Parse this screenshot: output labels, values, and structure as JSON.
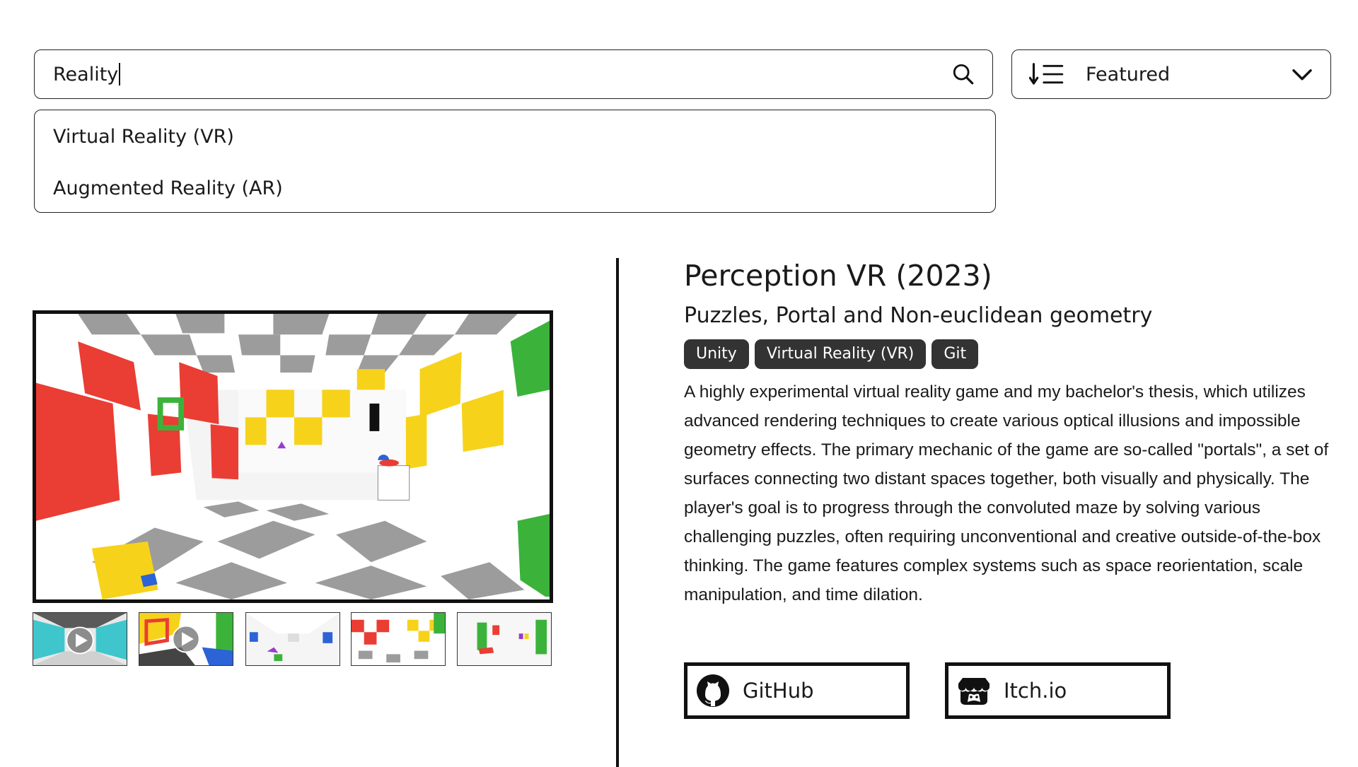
{
  "search": {
    "value": "Reality"
  },
  "sort": {
    "selected": "Featured",
    "icon": "sort-descending-icon"
  },
  "suggestions": [
    {
      "label": "Virtual Reality (VR)"
    },
    {
      "label": "Augmented Reality (AR)"
    }
  ],
  "project": {
    "title": "Perception VR (2023)",
    "subtitle": "Puzzles, Portal and Non-euclidean geometry",
    "tags": [
      "Unity",
      "Virtual Reality (VR)",
      "Git"
    ],
    "description": "A highly experimental virtual reality game and my bachelor's thesis, which utilizes advanced rendering techniques to create various optical illusions and impossible geometry effects. The primary mechanic of the game are so-called \"portals\", a set of surfaces connecting two distant spaces together, both visually and physically. The player's goal is to progress through the convoluted maze by solving various challenging puzzles, often requiring unconventional and creative outside-of-the-box thinking. The game features complex systems such as space reorientation, scale manipulation, and time dilation.",
    "links": [
      {
        "label": "GitHub",
        "icon": "github-icon"
      },
      {
        "label": "Itch.io",
        "icon": "itchio-icon"
      }
    ]
  },
  "colors": {
    "red": "#ea3d33",
    "yellow": "#f7d21a",
    "green": "#3bb33b",
    "blue": "#2c63d6",
    "teal": "#3fc6cc",
    "gray": "#9a9a9a"
  }
}
